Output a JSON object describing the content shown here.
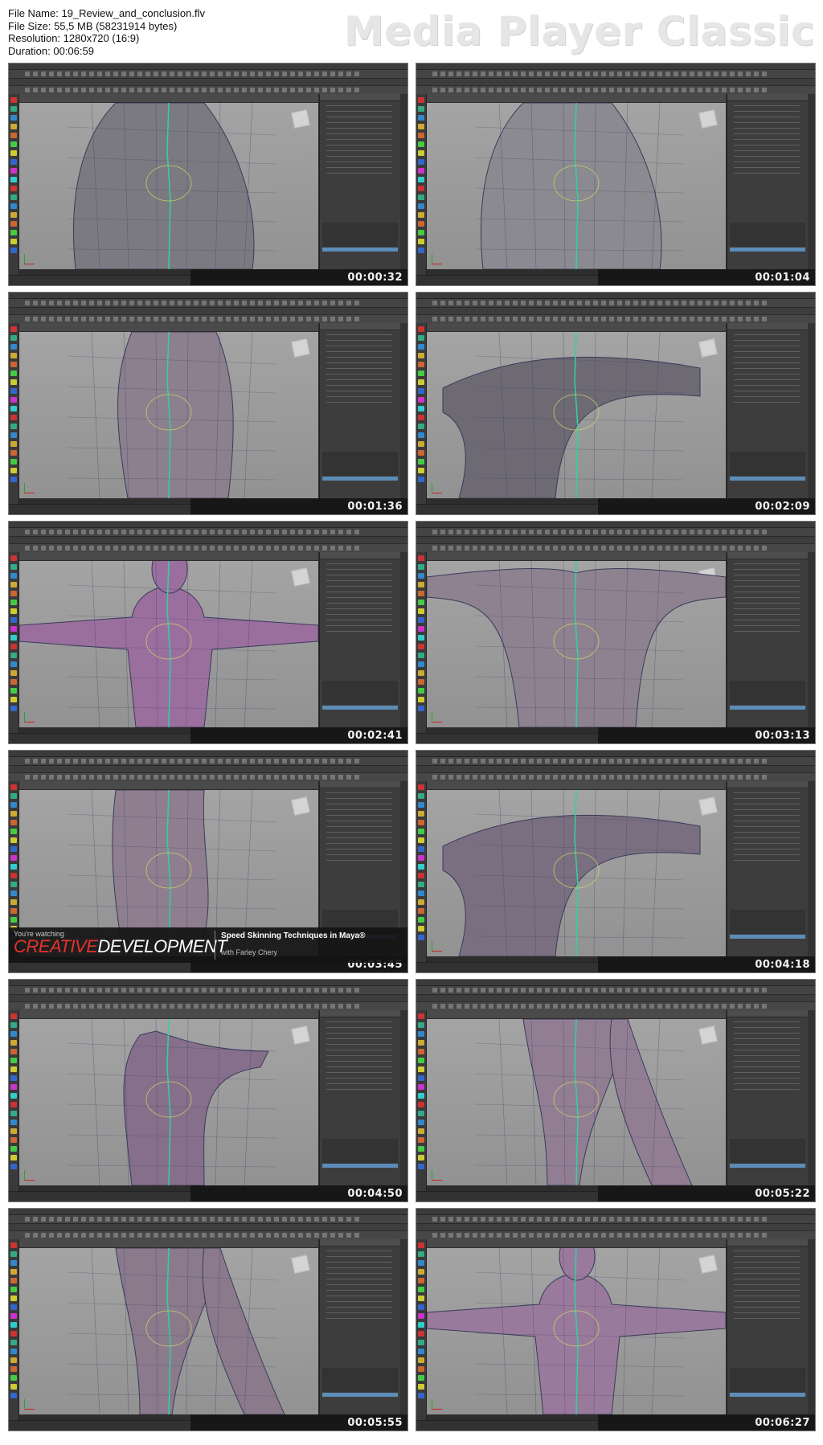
{
  "file_info": {
    "name_line": "File Name: 19_Review_and_conclusion.flv",
    "size_line": "File Size: 55,5 MB (58231914 bytes)",
    "resolution_line": "Resolution: 1280x720 (16:9)",
    "duration_line": "Duration: 00:06:59"
  },
  "brand": "Media Player Classic",
  "thumbnails": [
    {
      "timestamp": "00:00:32",
      "pose": "hip",
      "tint": "#7a7a80"
    },
    {
      "timestamp": "00:01:04",
      "pose": "hip",
      "tint": "#8a8a90"
    },
    {
      "timestamp": "00:01:36",
      "pose": "torso",
      "tint": "#8c7f8e"
    },
    {
      "timestamp": "00:02:09",
      "pose": "arm",
      "tint": "#6e6a74"
    },
    {
      "timestamp": "00:02:41",
      "pose": "front",
      "tint": "#9a6f9e"
    },
    {
      "timestamp": "00:03:13",
      "pose": "back",
      "tint": "#8e8290"
    },
    {
      "timestamp": "00:03:45",
      "pose": "leg",
      "tint": "#8e7e8f"
    },
    {
      "timestamp": "00:04:18",
      "pose": "arm",
      "tint": "#7a6f80"
    },
    {
      "timestamp": "00:04:50",
      "pose": "side",
      "tint": "#866f8a"
    },
    {
      "timestamp": "00:05:22",
      "pose": "legs",
      "tint": "#917e93"
    },
    {
      "timestamp": "00:05:55",
      "pose": "legs",
      "tint": "#8a7a8c"
    },
    {
      "timestamp": "00:06:27",
      "pose": "front",
      "tint": "#9a7a9c"
    }
  ],
  "overlay": {
    "watching": "You're watching",
    "brand_part1": "CREATIVE",
    "brand_part2": "DEVELOPMENT",
    "course_title": "Speed Skinning Techniques in Maya®",
    "author": "with Farley Chery"
  }
}
